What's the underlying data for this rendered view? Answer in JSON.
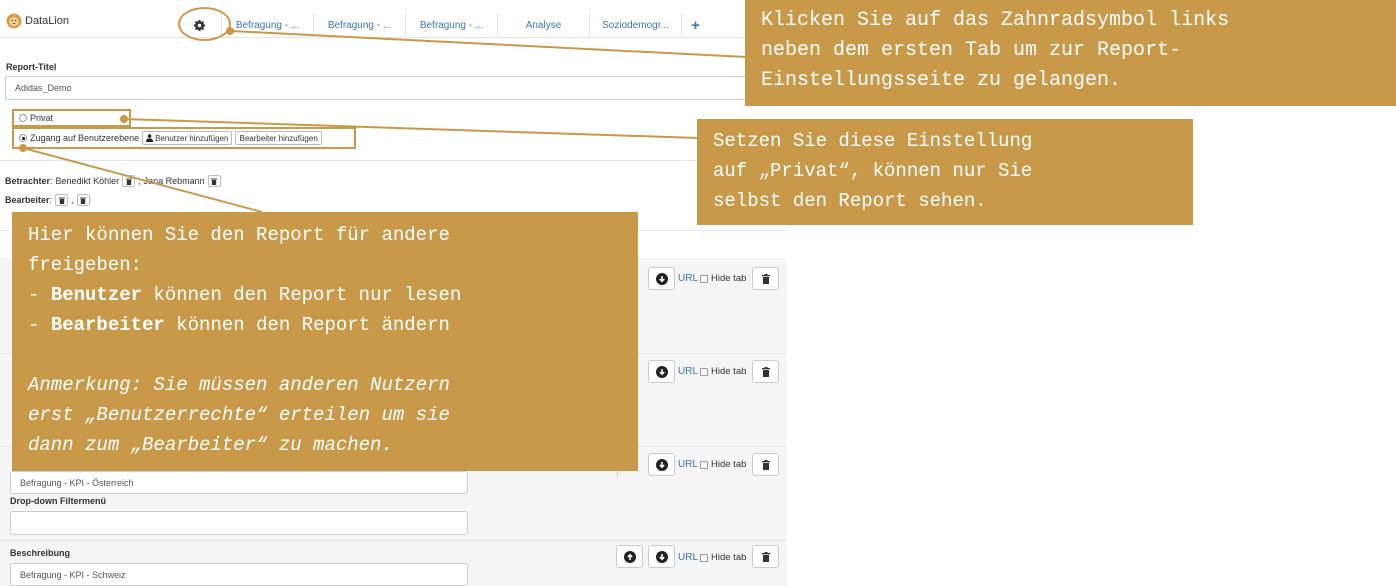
{
  "app": {
    "logo_text": "DataLion"
  },
  "tabs": [
    {
      "label": "Befragung - ..."
    },
    {
      "label": "Befragung - ..."
    },
    {
      "label": "Befragung - ..."
    },
    {
      "label": "Analyse"
    },
    {
      "label": "Soziodemogr..."
    }
  ],
  "icons": {
    "settings": "gear-icon",
    "add_tab": "plus-icon",
    "user": "user-icon",
    "trash": "trash-icon",
    "arrow_up": "arrow-up-circle-icon",
    "arrow_down": "arrow-down-circle-icon"
  },
  "report": {
    "title_label": "Report-Titel",
    "title_value": "Adidas_Demo"
  },
  "access": {
    "option_private": "Privat",
    "option_user_level": "Zugang auf Benutzerebene",
    "selected": "Zugang auf Benutzerebene",
    "add_user_button": "Benutzer hinzufügen",
    "add_editor_button": "Bearbeiter hinzufügen"
  },
  "viewers": {
    "label": "Betrachter",
    "people": [
      "Benedikt Köhler",
      "Jana Rebmann"
    ]
  },
  "editors": {
    "label": "Bearbeiter",
    "separator": ","
  },
  "tab_panels": [
    {
      "url_label": "URL",
      "hide_label": "Hide tab"
    },
    {
      "url_label": "URL",
      "hide_label": "Hide tab"
    },
    {
      "url_label": "URL",
      "hide_label": "Hide tab",
      "description_value": "Befragung - KPI - Österreich",
      "filter_label": "Drop-down Filtermenü",
      "filter_value": ""
    },
    {
      "url_label": "URL",
      "hide_label": "Hide tab",
      "description_label": "Beschreibung",
      "description_value": "Befragung - KPI - Schweiz"
    }
  ],
  "annotations": {
    "settings_hint": "Klicken Sie auf das Zahnradsymbol links\nneben dem ersten Tab um zur Report-\nEinstellungsseite zu gelangen.",
    "private_hint": "Setzen Sie diese Einstellung\nauf „Privat“, können nur Sie\nselbst den Report sehen.",
    "share_intro": "Hier können Sie den Report für andere\nfreigeben:",
    "share_users_prefix": "- ",
    "share_users_bold": "Benutzer",
    "share_users_rest": " können den Report nur lesen",
    "share_editors_prefix": "- ",
    "share_editors_bold": "Bearbeiter",
    "share_editors_rest": " können den Report ändern",
    "share_note": "Anmerkung: Sie müssen anderen Nutzern\nerst „Benutzerrechte“ erteilen um sie\ndann zum „Bearbeiter“ zu machen."
  },
  "colors": {
    "annotation": "#c9994a",
    "link": "#3a76b8",
    "panel_bg": "#f5f5f5"
  }
}
